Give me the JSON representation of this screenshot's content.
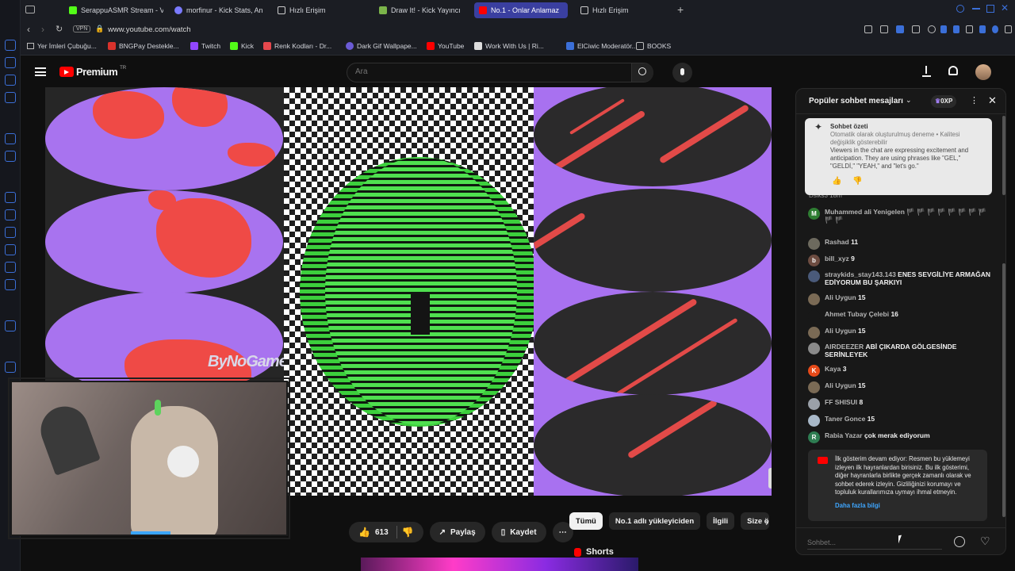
{
  "tabs": [
    {
      "label": "SerappuASMR Stream - V",
      "color": "#53fc18"
    },
    {
      "label": "morfinur - Kick Stats, An",
      "color": "#7a7aff"
    },
    {
      "label": "Hızlı Erişim",
      "color": "#cccccc"
    },
    {
      "label": "Draw It! - Kick Yayıncı",
      "color": "#53fc18"
    },
    {
      "label": "No.1 - Onlar Anlamaz",
      "color": "#ff0000"
    },
    {
      "label": "Hızlı Erişim",
      "color": "#cccccc"
    }
  ],
  "address": {
    "badge": "VPN",
    "url": "www.youtube.com/watch"
  },
  "bookmarks": [
    "Yer İmleri Çubuğu...",
    "BNGPay Destekle...",
    "Twitch",
    "Kick",
    "Renk Kodları - Dr...",
    "Dark Gif Wallpape...",
    "YouTube",
    "Work With Us | Ri...",
    "ElCiwic Moderatör...",
    "BOOKS"
  ],
  "yt": {
    "logo_text": "Premium",
    "logo_sup": "TR",
    "search_placeholder": "Ara"
  },
  "video": {
    "watermark": "ByNoGame"
  },
  "actions": {
    "likes": "613",
    "share": "Paylaş",
    "save": "Kaydet"
  },
  "chips": [
    "Tümü",
    "No.1 adlı yükleyiciden",
    "İlgili",
    "Size ö"
  ],
  "shorts_label": "Shorts",
  "chat": {
    "title": "Popüler sohbet mesajları",
    "xp": "0XP",
    "summary_title": "Sohbet özeti",
    "summary_sub": "Otomatik olarak oluşturulmuş deneme • Kalitesi değişiklik gösterebilir",
    "summary_body": "Viewers in the chat are expressing excitement and anticipation. They are using phrases like \"GEL,\" \"GELDİ,\" \"YEAH,\" and \"let's go.\"",
    "partial_author": "Dsiks3",
    "partial_text": "18m",
    "messages": [
      {
        "author": "Muhammed ali Yenigelen",
        "text": "🏴 🏴 🏴 🏴 🏴 🏴 🏴 🏴 🏴 🏴",
        "avatar": "M",
        "color": "#2e7d32"
      },
      {
        "author": "Rashad",
        "text": "11",
        "avatar": "",
        "color": "#6d6a5e"
      },
      {
        "author": "bill_xyz",
        "text": "9",
        "avatar": "b",
        "color": "#6d4c41"
      },
      {
        "author": "straykids_stay143.143",
        "text": "ENES SEVGİLİYE ARMAĞAN EDİYORUM BU ŞARKIYI",
        "avatar": "",
        "color": "#4a5a7a"
      },
      {
        "author": "Ali Uygun",
        "text": "15",
        "avatar": "",
        "color": "#7a6a55"
      },
      {
        "author": "Ahmet Tubay Çelebi",
        "text": "16",
        "avatar": "",
        "color": "#181818"
      },
      {
        "author": "Ali Uygun",
        "text": "15",
        "avatar": "",
        "color": "#7a6a55"
      },
      {
        "author": "AIRDEEZER",
        "text": "ABİ ÇIKARDA GÖLGESİNDE SERİNLEYEK",
        "avatar": "",
        "color": "#8a8a8a"
      },
      {
        "author": "Kaya",
        "text": "3",
        "avatar": "K",
        "color": "#e64a19"
      },
      {
        "author": "Ali Uygun",
        "text": "15",
        "avatar": "",
        "color": "#7a6a55"
      },
      {
        "author": "FF SHISUI",
        "text": "8",
        "avatar": "",
        "color": "#9aa0a8"
      },
      {
        "author": "Taner Gonce",
        "text": "15",
        "avatar": "",
        "color": "#a8b8c8"
      },
      {
        "author": "Rabia Yazar",
        "text": "çok merak ediyorum",
        "avatar": "R",
        "color": "#2e7d52"
      }
    ],
    "notice_text": "İlk gösterim devam ediyor: Resmen bu yüklemeyi izleyen ilk hayranlardan birisiniz. Bu ilk gösterimi, diğer hayranlarla birlikte gerçek zamanlı olarak ve sohbet ederek izleyin. Gizliliğinizi korumayı ve topluluk kurallarımıza uymayı ihmal etmeyin.",
    "notice_link": "Daha fazla bilgi",
    "input_placeholder": "Sohbet..."
  },
  "colors": {
    "accent": "#3ea6ff",
    "brand": "#ff0000",
    "kick": "#53fc18"
  }
}
